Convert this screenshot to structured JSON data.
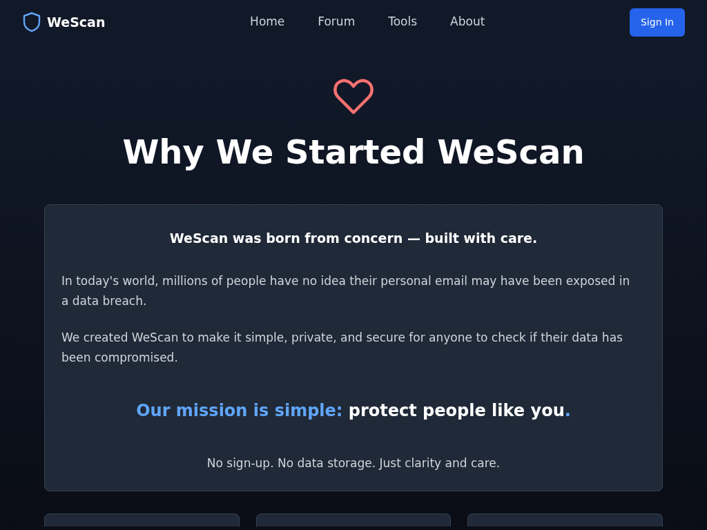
{
  "navbar": {
    "brand": "WeScan",
    "links": [
      {
        "label": "Home"
      },
      {
        "label": "Forum"
      },
      {
        "label": "Tools"
      },
      {
        "label": "About"
      }
    ],
    "sign_in": "Sign In"
  },
  "heading": "Why We Started WeScan",
  "story": {
    "lead": "WeScan was born from concern — built with care.",
    "paragraphs": [
      "In today's world, millions of people have no idea their personal email may have been exposed in a data breach.",
      "We created WeScan to make it simple, private, and secure for anyone to check if their data has been compromised."
    ],
    "mission": [
      {
        "text": "Our mission is simple:",
        "accent": true
      },
      {
        "text": " protect people like you",
        "accent": false
      },
      {
        "text": ".",
        "accent": true
      }
    ],
    "footnote": "No sign-up. No data storage. Just clarity and care."
  },
  "feature_cards": [
    {
      "kind": "card"
    },
    {
      "kind": "card"
    },
    {
      "kind": "card"
    }
  ]
}
